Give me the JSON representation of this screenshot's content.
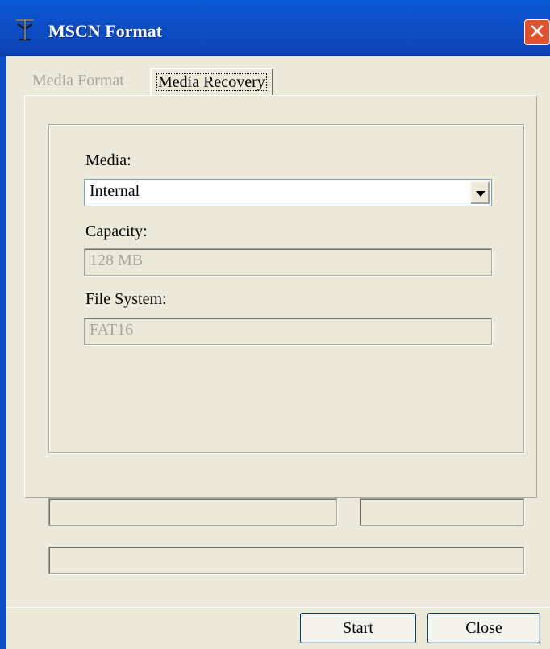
{
  "window": {
    "title": "MSCN Format",
    "close_label": "✕"
  },
  "tabs": [
    {
      "label": "Media Format",
      "active": false
    },
    {
      "label": "Media Recovery",
      "active": true
    }
  ],
  "form": {
    "media_label": "Media:",
    "media_value": "Internal",
    "capacity_label": "Capacity:",
    "capacity_value": "128 MB",
    "filesystem_label": "File System:",
    "filesystem_value": "FAT16"
  },
  "buttons": {
    "start": "Start",
    "close": "Close"
  },
  "colors": {
    "titlebar": "#0b56d4",
    "close_button": "#e0512e",
    "dialog_bg": "#ece9d8"
  }
}
